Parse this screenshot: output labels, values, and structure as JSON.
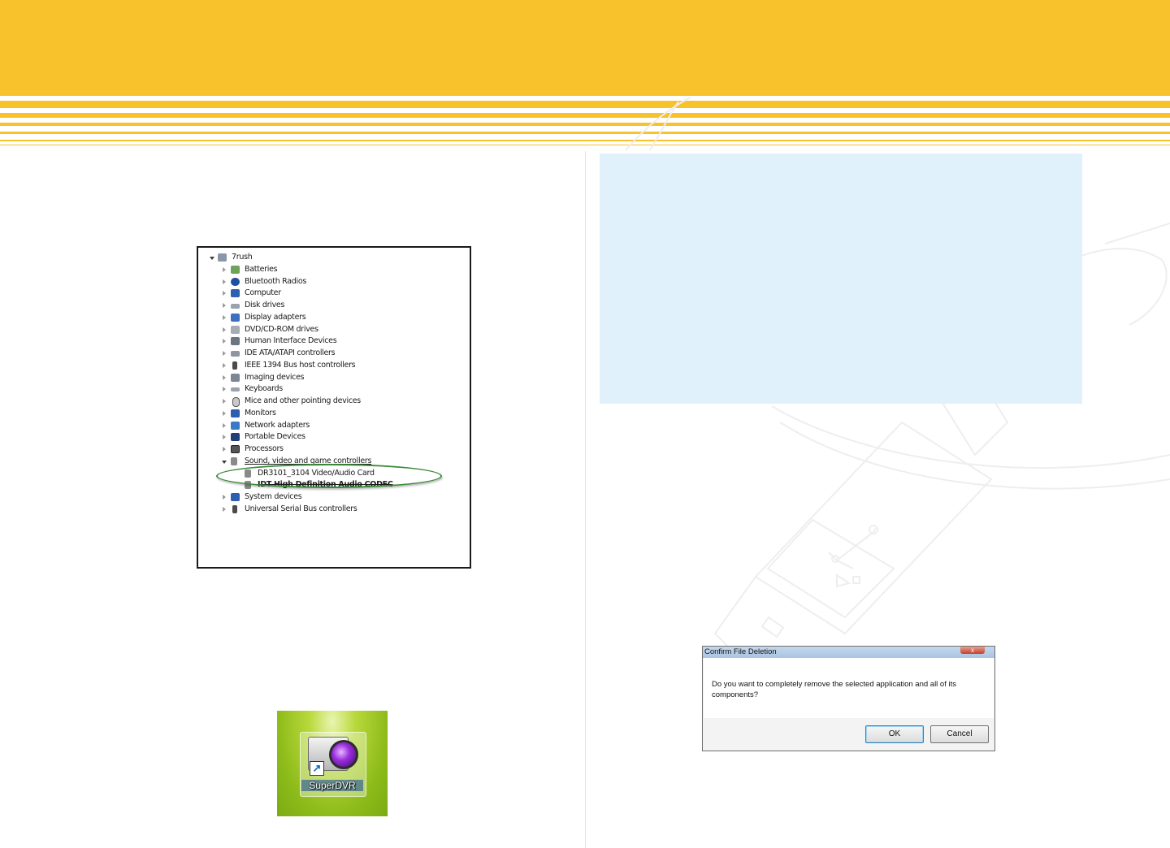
{
  "device_manager": {
    "root": "7rush",
    "items": [
      {
        "label": "Batteries"
      },
      {
        "label": "Bluetooth Radios"
      },
      {
        "label": "Computer"
      },
      {
        "label": "Disk drives"
      },
      {
        "label": "Display adapters"
      },
      {
        "label": "DVD/CD-ROM drives"
      },
      {
        "label": "Human Interface Devices"
      },
      {
        "label": "IDE ATA/ATAPI controllers"
      },
      {
        "label": "IEEE 1394 Bus host controllers"
      },
      {
        "label": "Imaging devices"
      },
      {
        "label": "Keyboards"
      },
      {
        "label": "Mice and other pointing devices"
      },
      {
        "label": "Monitors"
      },
      {
        "label": "Network adapters"
      },
      {
        "label": "Portable Devices"
      },
      {
        "label": "Processors"
      },
      {
        "label": "Sound, video and game controllers"
      }
    ],
    "sound_children": [
      {
        "label": "DR3101_3104 Video/Audio Card"
      },
      {
        "label": "IDT High Definition Audio CODEC"
      }
    ],
    "items_after": [
      {
        "label": "System devices"
      },
      {
        "label": "Universal Serial Bus controllers"
      }
    ]
  },
  "desktop_icon": {
    "label": "SuperDVR"
  },
  "confirm_dialog": {
    "title": "Confirm File Deletion",
    "close_glyph": "x",
    "message": "Do you want to completely remove the selected application and all of its components?",
    "ok_label": "OK",
    "cancel_label": "Cancel"
  },
  "colors": {
    "header": "#f8c22c",
    "info_box": "#e1f1fc",
    "highlight_oval": "#3a8c3a"
  }
}
